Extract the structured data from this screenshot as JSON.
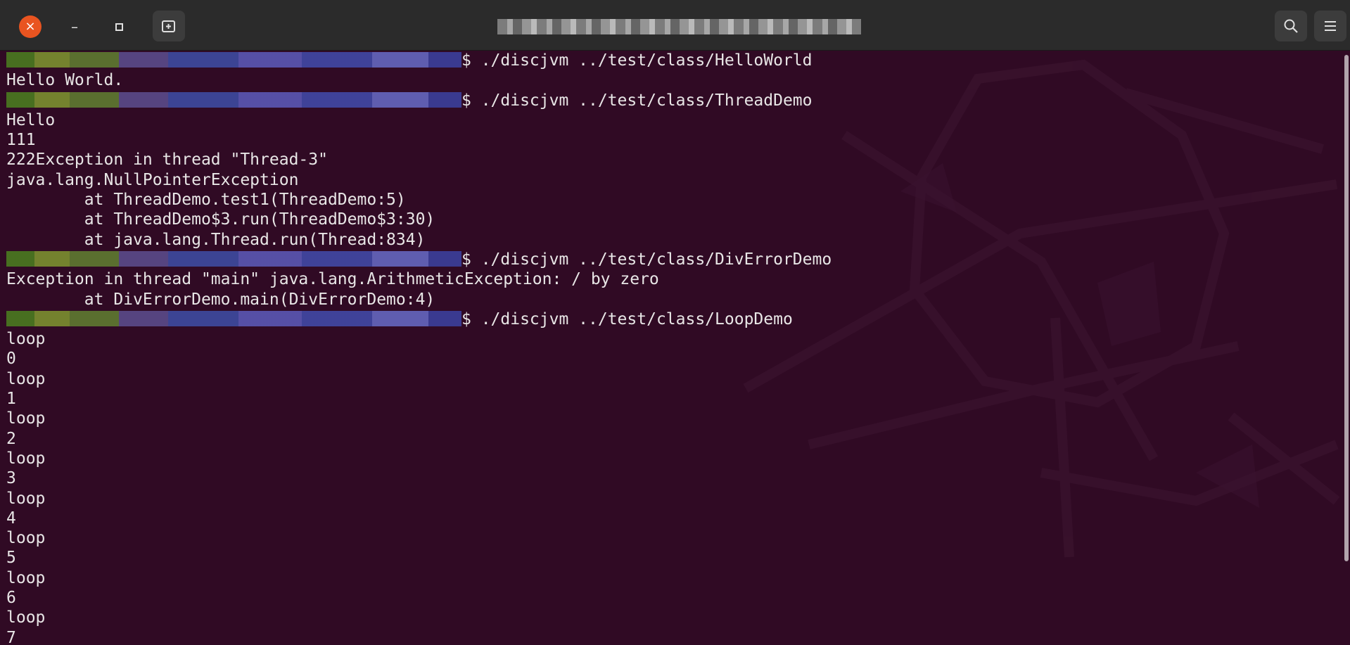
{
  "window": {
    "close_icon": "×",
    "minimize_icon": "–"
  },
  "terminal": {
    "lines": [
      {
        "prompt_redacted": true,
        "text": "$ ./discjvm ../test/class/HelloWorld"
      },
      {
        "prompt_redacted": false,
        "text": "Hello World."
      },
      {
        "prompt_redacted": true,
        "text": "$ ./discjvm ../test/class/ThreadDemo"
      },
      {
        "prompt_redacted": false,
        "text": "Hello"
      },
      {
        "prompt_redacted": false,
        "text": "111"
      },
      {
        "prompt_redacted": false,
        "text": "222Exception in thread \"Thread-3\""
      },
      {
        "prompt_redacted": false,
        "text": "java.lang.NullPointerException"
      },
      {
        "prompt_redacted": false,
        "text": "        at ThreadDemo.test1(ThreadDemo:5)"
      },
      {
        "prompt_redacted": false,
        "text": "        at ThreadDemo$3.run(ThreadDemo$3:30)"
      },
      {
        "prompt_redacted": false,
        "text": "        at java.lang.Thread.run(Thread:834)"
      },
      {
        "prompt_redacted": true,
        "text": "$ ./discjvm ../test/class/DivErrorDemo"
      },
      {
        "prompt_redacted": false,
        "text": "Exception in thread \"main\" java.lang.ArithmeticException: / by zero"
      },
      {
        "prompt_redacted": false,
        "text": "        at DivErrorDemo.main(DivErrorDemo:4)"
      },
      {
        "prompt_redacted": true,
        "text": "$ ./discjvm ../test/class/LoopDemo"
      },
      {
        "prompt_redacted": false,
        "text": "loop"
      },
      {
        "prompt_redacted": false,
        "text": "0"
      },
      {
        "prompt_redacted": false,
        "text": "loop"
      },
      {
        "prompt_redacted": false,
        "text": "1"
      },
      {
        "prompt_redacted": false,
        "text": "loop"
      },
      {
        "prompt_redacted": false,
        "text": "2"
      },
      {
        "prompt_redacted": false,
        "text": "loop"
      },
      {
        "prompt_redacted": false,
        "text": "3"
      },
      {
        "prompt_redacted": false,
        "text": "loop"
      },
      {
        "prompt_redacted": false,
        "text": "4"
      },
      {
        "prompt_redacted": false,
        "text": "loop"
      },
      {
        "prompt_redacted": false,
        "text": "5"
      },
      {
        "prompt_redacted": false,
        "text": "loop"
      },
      {
        "prompt_redacted": false,
        "text": "6"
      },
      {
        "prompt_redacted": false,
        "text": "loop"
      },
      {
        "prompt_redacted": false,
        "text": "7"
      }
    ]
  },
  "colors": {
    "background": "#300a24",
    "foreground": "#e8e6e6",
    "close_button": "#e95420",
    "headerbar": "#2b2b2b"
  },
  "icons": {
    "close": "close-icon",
    "minimize": "minimize-icon",
    "maximize": "maximize-icon",
    "new_tab": "new-tab-icon",
    "search": "search-icon",
    "menu": "hamburger-menu-icon"
  }
}
